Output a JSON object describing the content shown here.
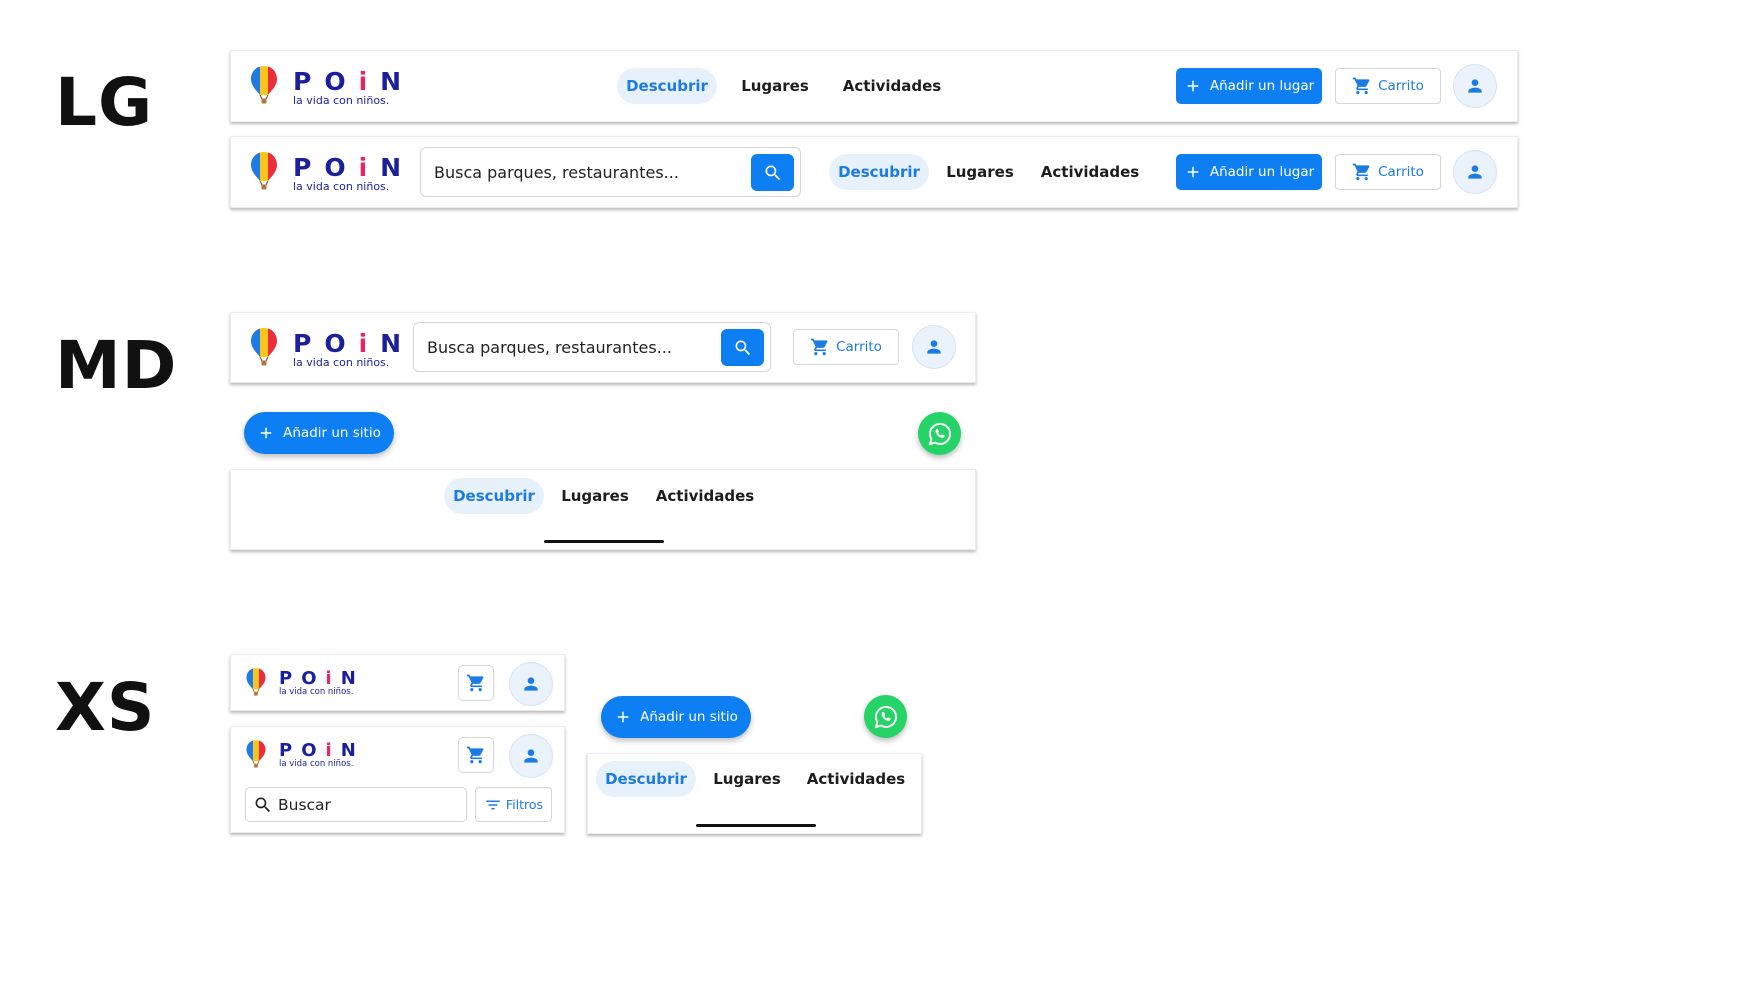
{
  "breakpoints": {
    "lg": "LG",
    "md": "MD",
    "xs": "XS"
  },
  "brand": {
    "letters": [
      "P",
      "O",
      "i",
      "N"
    ],
    "tagline": "la vida con niños."
  },
  "nav": {
    "discover": "Descubrir",
    "places": "Lugares",
    "activities": "Actividades"
  },
  "buttons": {
    "add_place": "Añadir un lugar",
    "add_site": "Añadir un sitio",
    "cart": "Carrito",
    "filters": "Filtros"
  },
  "search": {
    "placeholder": "Busca parques, restaurantes...",
    "xs_placeholder": "Buscar"
  },
  "colors": {
    "primary": "#0d7ff2",
    "brand_navy": "#1a1f9e",
    "brand_pink": "#e6246a",
    "whatsapp": "#25d366",
    "active_tab_bg": "#e7f1fb"
  },
  "icons": [
    "balloon-logo-icon",
    "plus-icon",
    "cart-icon",
    "user-icon",
    "search-icon",
    "whatsapp-icon",
    "filter-icon"
  ]
}
